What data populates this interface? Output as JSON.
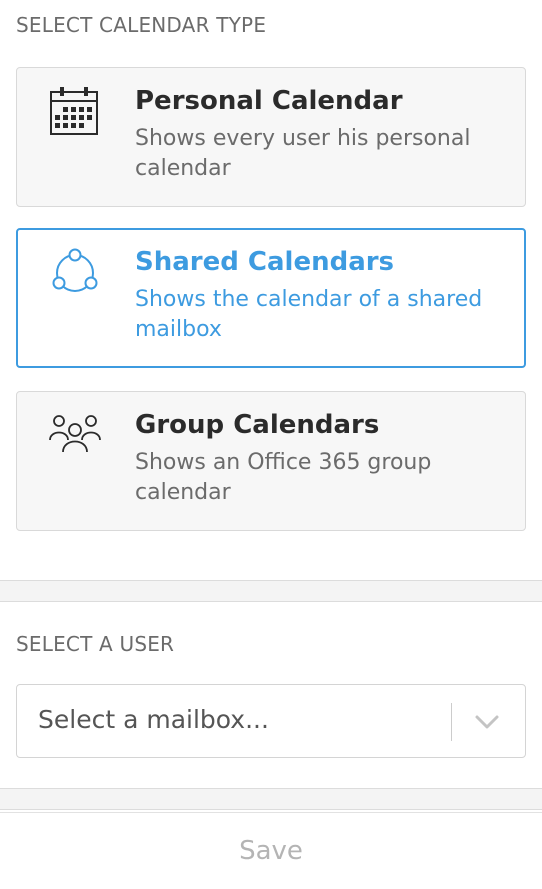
{
  "calendar_type": {
    "heading": "SELECT CALENDAR TYPE",
    "options": [
      {
        "title": "Personal Calendar",
        "description": "Shows every user his personal calendar",
        "icon": "calendar-icon",
        "selected": false
      },
      {
        "title": "Shared Calendars",
        "description": "Shows the calendar of a shared mailbox",
        "icon": "share-icon",
        "selected": true
      },
      {
        "title": "Group Calendars",
        "description": "Shows an Office 365 group calendar",
        "icon": "group-icon",
        "selected": false
      }
    ]
  },
  "user_select": {
    "heading": "SELECT A USER",
    "placeholder": "Select a mailbox...",
    "chevron_icon": "chevron-down-icon"
  },
  "footer": {
    "save_label": "Save"
  },
  "colors": {
    "accent": "#3d9be0",
    "text": "#2b2b2b",
    "muted": "#6b6b6b",
    "disabled": "#b4b4b4"
  }
}
